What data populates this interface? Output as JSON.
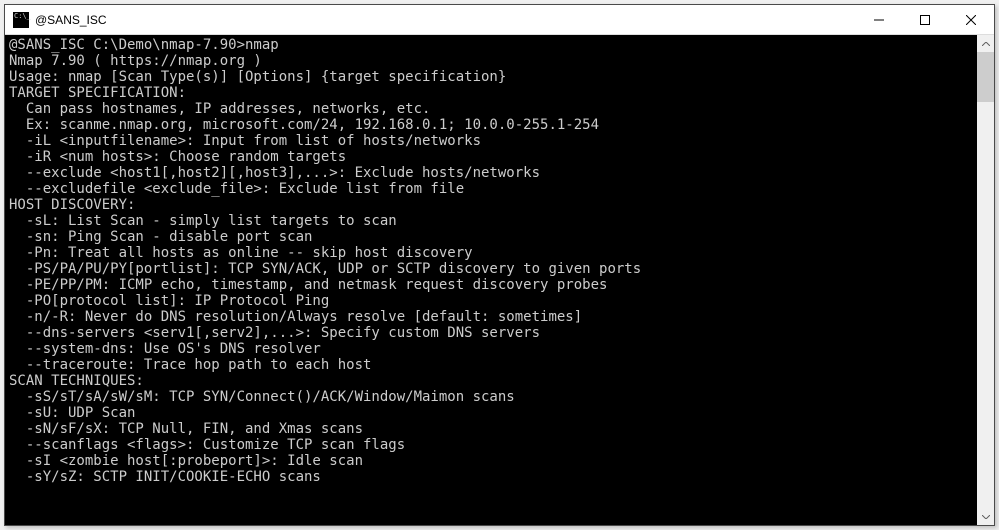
{
  "window": {
    "title": "@SANS_ISC"
  },
  "terminal": {
    "lines": [
      "",
      "@SANS_ISC C:\\Demo\\nmap-7.90>nmap",
      "Nmap 7.90 ( https://nmap.org )",
      "Usage: nmap [Scan Type(s)] [Options] {target specification}",
      "TARGET SPECIFICATION:",
      "  Can pass hostnames, IP addresses, networks, etc.",
      "  Ex: scanme.nmap.org, microsoft.com/24, 192.168.0.1; 10.0.0-255.1-254",
      "  -iL <inputfilename>: Input from list of hosts/networks",
      "  -iR <num hosts>: Choose random targets",
      "  --exclude <host1[,host2][,host3],...>: Exclude hosts/networks",
      "  --excludefile <exclude_file>: Exclude list from file",
      "HOST DISCOVERY:",
      "  -sL: List Scan - simply list targets to scan",
      "  -sn: Ping Scan - disable port scan",
      "  -Pn: Treat all hosts as online -- skip host discovery",
      "  -PS/PA/PU/PY[portlist]: TCP SYN/ACK, UDP or SCTP discovery to given ports",
      "  -PE/PP/PM: ICMP echo, timestamp, and netmask request discovery probes",
      "  -PO[protocol list]: IP Protocol Ping",
      "  -n/-R: Never do DNS resolution/Always resolve [default: sometimes]",
      "  --dns-servers <serv1[,serv2],...>: Specify custom DNS servers",
      "  --system-dns: Use OS's DNS resolver",
      "  --traceroute: Trace hop path to each host",
      "SCAN TECHNIQUES:",
      "  -sS/sT/sA/sW/sM: TCP SYN/Connect()/ACK/Window/Maimon scans",
      "  -sU: UDP Scan",
      "  -sN/sF/sX: TCP Null, FIN, and Xmas scans",
      "  --scanflags <flags>: Customize TCP scan flags",
      "  -sI <zombie host[:probeport]>: Idle scan",
      "  -sY/sZ: SCTP INIT/COOKIE-ECHO scans"
    ]
  }
}
